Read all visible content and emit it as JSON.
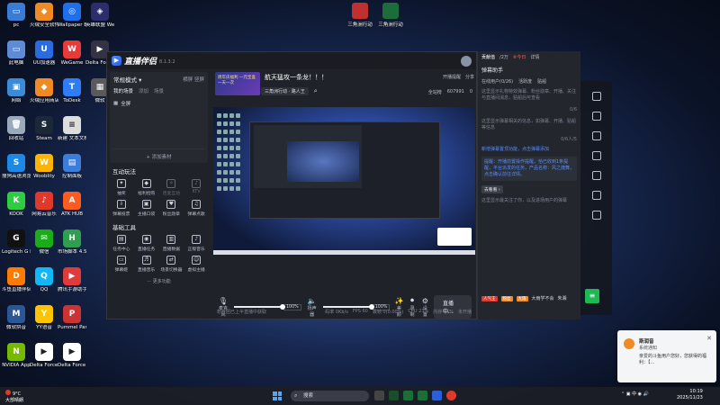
{
  "desktop": {
    "icons": [
      {
        "label": "pc",
        "color": "#3a7bd5",
        "glyph": "▭"
      },
      {
        "label": "火绒安全软件",
        "color": "#f08a24",
        "glyph": "◆"
      },
      {
        "label": "Wallpaper Engine:...",
        "color": "#1f6feb",
        "glyph": "◎"
      },
      {
        "label": "英雄联盟 WeGame版",
        "color": "#2b2e6b",
        "glyph": "◈"
      },
      {
        "label": "此电脑",
        "color": "#5d8bd6",
        "glyph": "▭"
      },
      {
        "label": "UU加速器",
        "color": "#2a6cdf",
        "glyph": "U"
      },
      {
        "label": "WeGame",
        "color": "#e83a3a",
        "glyph": "W"
      },
      {
        "label": "Delta Force 2025.11.20...",
        "color": "#334",
        "glyph": "▶"
      },
      {
        "label": "网络",
        "color": "#3c8bd8",
        "glyph": "▣"
      },
      {
        "label": "火绒应用商店",
        "color": "#f08a24",
        "glyph": "◆"
      },
      {
        "label": "ToDesk",
        "color": "#2e7df6",
        "glyph": "T"
      },
      {
        "label": "微软",
        "color": "#5a5a5a",
        "glyph": "▦"
      },
      {
        "label": "回收站",
        "color": "#9ab",
        "glyph": "🗑"
      },
      {
        "label": "Steam",
        "color": "#1b2838",
        "glyph": "S"
      },
      {
        "label": "新建 文本文档",
        "color": "#ddd",
        "glyph": "≡"
      },
      {
        "label": "",
        "color": "transparent",
        "glyph": ""
      },
      {
        "label": "搜狗高速浏览器",
        "color": "#1e88e5",
        "glyph": "S"
      },
      {
        "label": "Wooblity",
        "color": "#ffb400",
        "glyph": "W"
      },
      {
        "label": "控制面板",
        "color": "#3b7dd8",
        "glyph": "▤"
      },
      {
        "label": "",
        "color": "transparent",
        "glyph": ""
      },
      {
        "label": "KOOK",
        "color": "#2ecc40",
        "glyph": "K"
      },
      {
        "label": "网易云音乐",
        "color": "#e0392b",
        "glyph": "♪"
      },
      {
        "label": "ATK HUB",
        "color": "#ff5a1f",
        "glyph": "A"
      },
      {
        "label": "",
        "color": "transparent",
        "glyph": ""
      },
      {
        "label": "Logitech G HUB",
        "color": "#111",
        "glyph": "G"
      },
      {
        "label": "微信",
        "color": "#1aad19",
        "glyph": "✉"
      },
      {
        "label": "市场脚本 4.5(1)",
        "color": "#2e9e4f",
        "glyph": "H"
      },
      {
        "label": "",
        "color": "transparent",
        "glyph": ""
      },
      {
        "label": "斗鱼直播伴侣",
        "color": "#ff7a00",
        "glyph": "D"
      },
      {
        "label": "QQ",
        "color": "#12b7f5",
        "glyph": "Q"
      },
      {
        "label": "腾讯手游助手-畅玩手机...",
        "color": "#e03a3a",
        "glyph": "▶"
      },
      {
        "label": "",
        "color": "transparent",
        "glyph": ""
      },
      {
        "label": "微软拼音",
        "color": "#2b5797",
        "glyph": "M"
      },
      {
        "label": "YY语音",
        "color": "#ffc400",
        "glyph": "Y"
      },
      {
        "label": "Pummel Party",
        "color": "#c33",
        "glyph": "P"
      },
      {
        "label": "",
        "color": "transparent",
        "glyph": ""
      },
      {
        "label": "NVIDIA App",
        "color": "#76b900",
        "glyph": "N"
      },
      {
        "label": "Delta Force 2025.11.20...",
        "color": "#fff",
        "glyph": "▶"
      },
      {
        "label": "Delta Force 2025.11.20...",
        "color": "#fff",
        "glyph": "▶"
      }
    ],
    "top_icons": [
      {
        "label": "三角洲行动",
        "color": "#c03030"
      },
      {
        "label": "三角洲行动",
        "color": "#1d6d3a"
      }
    ]
  },
  "app": {
    "name": "直播伴侣",
    "version": "8.1.3.2"
  },
  "left": {
    "mode_label": "常规模式 ▾",
    "mode_right": "横屏 竖屏",
    "tabs": [
      "我的场景",
      "添加",
      "场景"
    ],
    "scene": "全屏",
    "add_material": "+ 添加素材",
    "interact_title": "互动玩法",
    "interact_tools": [
      {
        "label": "抽奖",
        "dim": false
      },
      {
        "label": "福利抢购",
        "dim": false
      },
      {
        "label": "连麦互动",
        "dim": true
      },
      {
        "label": "KTV",
        "dim": true
      },
      {
        "label": "弹幕投票",
        "dim": false
      },
      {
        "label": "主播口袋",
        "dim": false
      },
      {
        "label": "粉丝勋章",
        "dim": false
      },
      {
        "label": "弹幕点歌",
        "dim": false
      }
    ],
    "base_title": "基础工具",
    "base_tools": [
      {
        "label": "任务中心"
      },
      {
        "label": "直播任务"
      },
      {
        "label": "直播数据"
      },
      {
        "label": "正版音乐"
      },
      {
        "label": "弹幕姬"
      },
      {
        "label": "直播音乐"
      },
      {
        "label": "场景切换器"
      },
      {
        "label": "虚拟主播"
      }
    ],
    "more": "⋯ 更多功能"
  },
  "center": {
    "stream_title": "航天猛攻一条龙！！！",
    "category": "三角洲行动 · 路人王",
    "actions": [
      "开播提醒",
      "分享"
    ],
    "stats": [
      "全站榜",
      "607991",
      "0"
    ],
    "cover_text": "周年庆福利 一元宝盒 一天一次",
    "controls": {
      "mic_label": "麦克风",
      "mic_pct": "100%",
      "spk_label": "扬声器",
      "spk_pct": "100%",
      "mic_level": 1.0,
      "spk_level": 1.0,
      "beauty": "美颜",
      "record": "录制",
      "settings": "设置",
      "go_live": "直播中..."
    },
    "status": {
      "hint": "粉丝团已上半直播中获取",
      "bitrate": "码率 0Kb/s",
      "fps": "FPS 60",
      "drop": "丢帧 0(0.00%)",
      "cpu": "CPU 23%",
      "mem": "内存 55%",
      "net": "未开播"
    }
  },
  "right": {
    "tabs": [
      "贡献值",
      "/2万",
      "⑥今日",
      "详情"
    ],
    "title": "弹幕助手",
    "sub": [
      "在线用户(0/26)",
      "活跃度",
      "贴船"
    ],
    "text1": "这里显示礼物特效弹幕、粉丝勋章、开播、关注与直播间消息，贴船后可查看",
    "counter1": "0/6",
    "text2": "这里显示弹幕相关的信息，如弹幕、开播、贴船等信息",
    "counter2": "0/6人/5",
    "blue1": "新增弹幕置顶功能，点击弹幕添加",
    "box": "提醒：开播前置操作提醒，恰已收到1条提醒，平台派发的任务，产品名称：风之捷舞，点击确认前往详情。",
    "btn": "去看看 ›",
    "text3": "这里显示最关注了你，以及进场用户的弹幕",
    "bottom_tags": [
      "人气王",
      "粉丝",
      "大雨"
    ],
    "bottom_text": "大雨学不会",
    "bottom_name": "朱湘"
  },
  "toast": {
    "title": "斯润音",
    "source": "系统通知",
    "body": "亲爱的斗鱼用户您好，您获得的福利：【...",
    "close": "✕"
  },
  "taskbar": {
    "weather_temp": "9°C",
    "weather_desc": "大部晴朗",
    "search": "搜索",
    "time": "10:19",
    "date": "2025/11/23"
  }
}
